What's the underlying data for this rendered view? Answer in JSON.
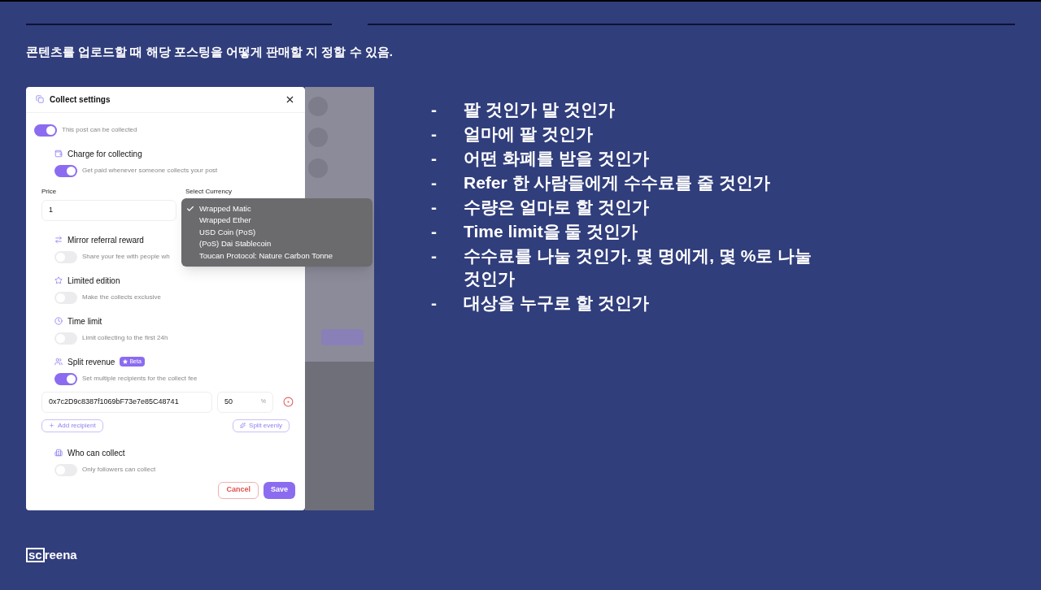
{
  "slide": {
    "heading": "콘텐츠를 업로드할 때 해당 포스팅을 어떻게 판매할 지 정할 수 있음.",
    "bullets": [
      {
        "marker": "-",
        "text": "팔 것인가 말 것인가"
      },
      {
        "marker": "-",
        "text": "얼마에 팔 것인가"
      },
      {
        "marker": "-",
        "text": "어떤 화폐를 받을 것인가"
      },
      {
        "marker": "-",
        "text": "Refer 한 사람들에게 수수료를 줄 것인가"
      },
      {
        "marker": "-",
        "text": "수량은 얼마로 할 것인가"
      },
      {
        "marker": "-",
        "text": "Time limit을 둘 것인가"
      },
      {
        "marker": "-",
        "text": "수수료를 나눌 것인가. 몇 명에게, 몇 %로 나눌 것인가"
      },
      {
        "marker": "-",
        "text": "대상을 누구로 할 것인가"
      }
    ],
    "logo": {
      "boxed": "sc",
      "rest": "reena"
    }
  },
  "dialog": {
    "title": "Collect settings",
    "collect_toggle": {
      "label": "This post can be collected",
      "on": true
    },
    "sections": [
      {
        "kind": "charge",
        "title": "Charge for collecting",
        "toggle": {
          "label": "Get paid whenever someone collects your post",
          "on": true
        }
      },
      {
        "kind": "mirror",
        "title": "Mirror referral reward",
        "toggle": {
          "label": "Share your fee with people wh",
          "on": false
        }
      },
      {
        "kind": "limited",
        "title": "Limited edition",
        "toggle": {
          "label": "Make the collects exclusive",
          "on": false
        }
      },
      {
        "kind": "time",
        "title": "Time limit",
        "toggle": {
          "label": "Limit collecting to the first 24h",
          "on": false
        }
      },
      {
        "kind": "split",
        "title": "Split revenue",
        "badge": "Beta",
        "toggle": {
          "label": "Set multiple recipients for the collect fee",
          "on": true
        }
      },
      {
        "kind": "who",
        "title": "Who can collect",
        "toggle": {
          "label": "Only followers can collect",
          "on": false
        }
      }
    ],
    "price": {
      "label": "Price",
      "value": "1"
    },
    "currency": {
      "label": "Select Currency",
      "options": [
        {
          "label": "Wrapped Matic",
          "selected": true
        },
        {
          "label": "Wrapped Ether",
          "selected": false
        },
        {
          "label": "USD Coin (PoS)",
          "selected": false
        },
        {
          "label": "(PoS) Dai Stablecoin",
          "selected": false
        },
        {
          "label": "Toucan Protocol: Nature Carbon Tonne",
          "selected": false
        }
      ]
    },
    "recipient": {
      "address": "0x7c2D9c8387f1069bF73e7e85C48741",
      "percent": "50",
      "unit": "%"
    },
    "add_recipient": "Add recipient",
    "split_evenly": "Split evenly",
    "cancel": "Cancel",
    "save": "Save"
  }
}
